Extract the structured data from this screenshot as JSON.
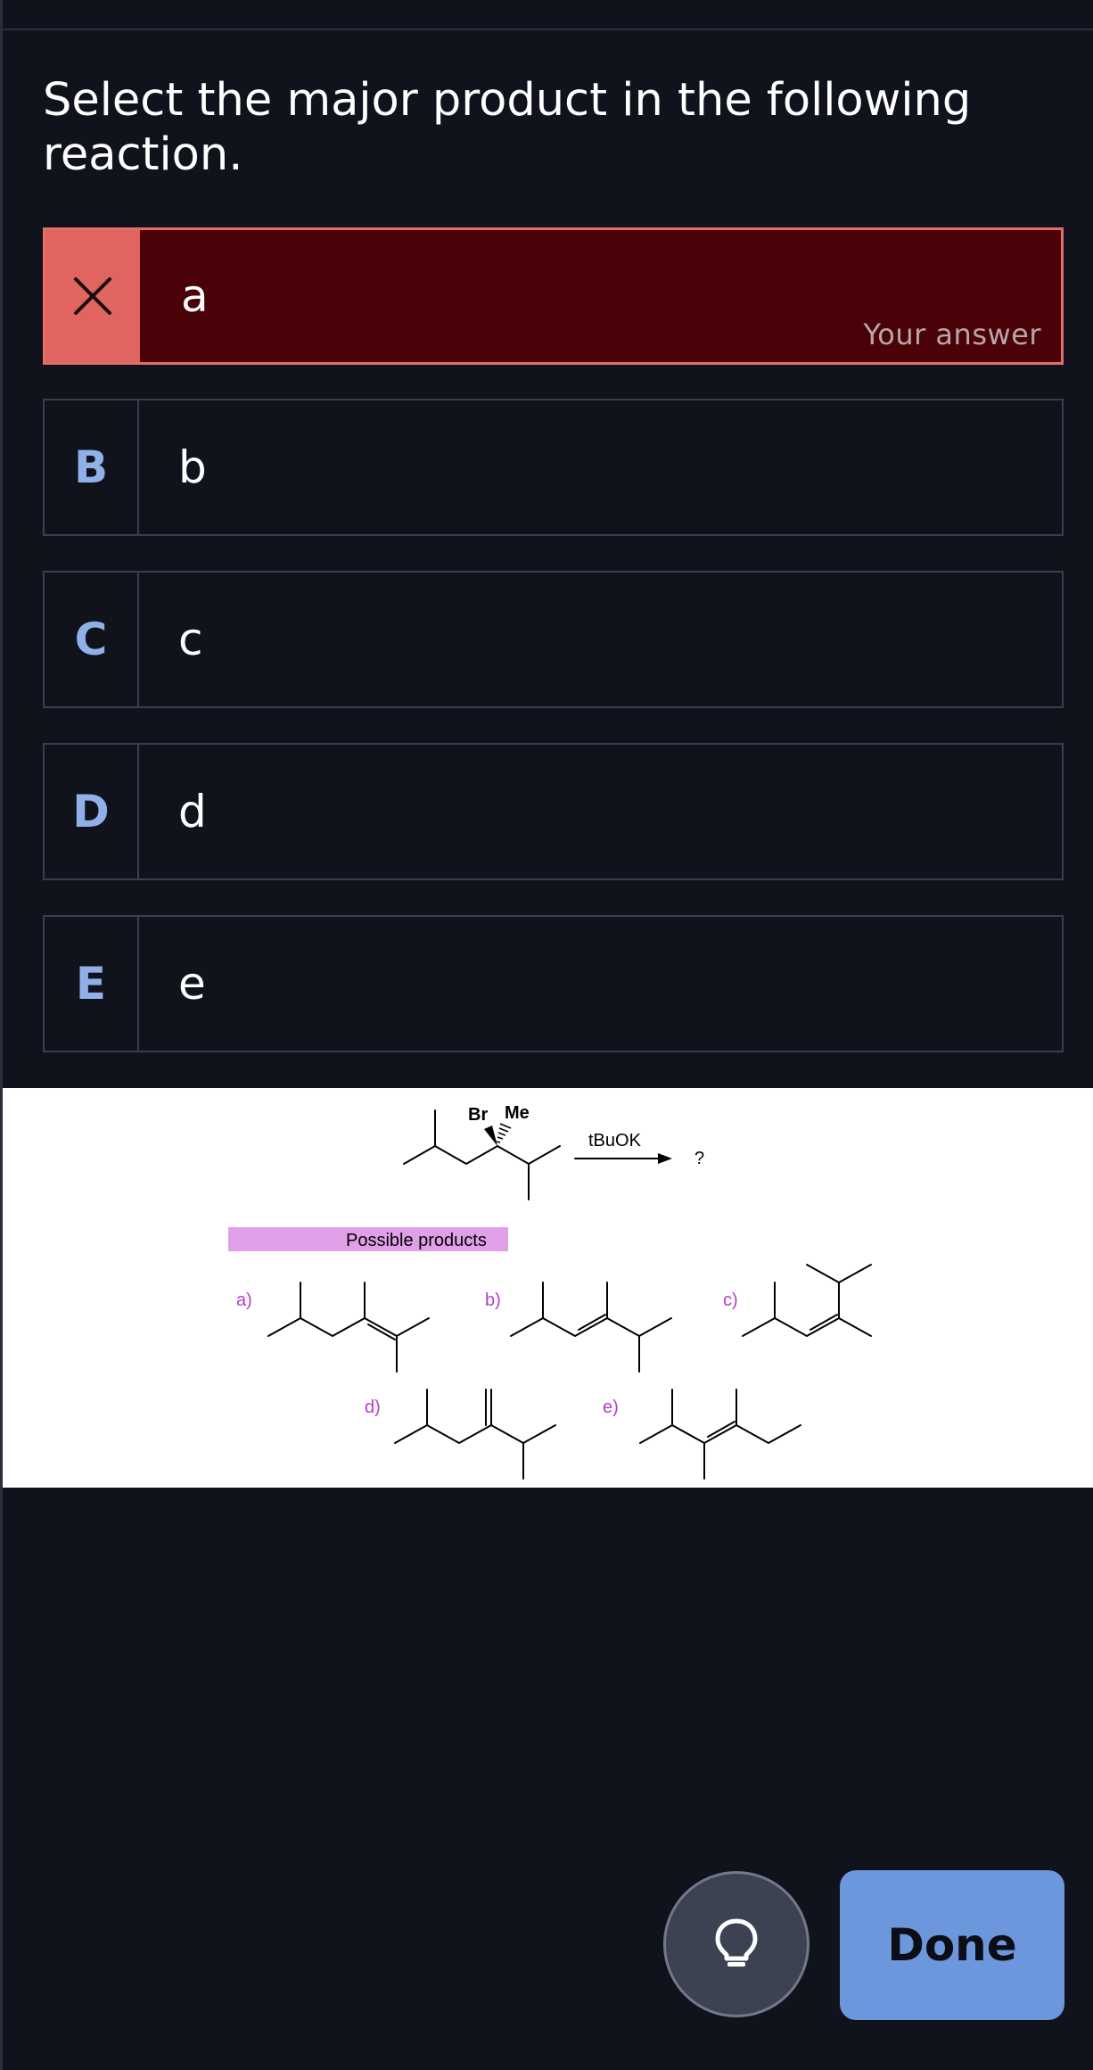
{
  "question": "Select the major product in the following reaction.",
  "options": [
    {
      "key": "",
      "label": "a",
      "state": "incorrect-selected",
      "note": "Your answer",
      "icon": "close-icon"
    },
    {
      "key": "B",
      "label": "b"
    },
    {
      "key": "C",
      "label": "c"
    },
    {
      "key": "D",
      "label": "d"
    },
    {
      "key": "E",
      "label": "e"
    }
  ],
  "figure": {
    "reactant_labels": {
      "br": "Br",
      "me": "Me"
    },
    "reagent": "tBuOK",
    "unknown": "?",
    "products_heading": "Possible products",
    "product_labels": [
      "a)",
      "b)",
      "c)",
      "d)",
      "e)"
    ]
  },
  "actions": {
    "hint_icon": "lightbulb-icon",
    "done_label": "Done"
  },
  "colors": {
    "background": "#10131b",
    "incorrect_fill": "#4a0208",
    "incorrect_border": "#e36d6a",
    "key_letter": "#8fb1e8",
    "done_button": "#6c97dc",
    "products_highlight": "#e0a0e8",
    "product_label": "#b040c8"
  }
}
